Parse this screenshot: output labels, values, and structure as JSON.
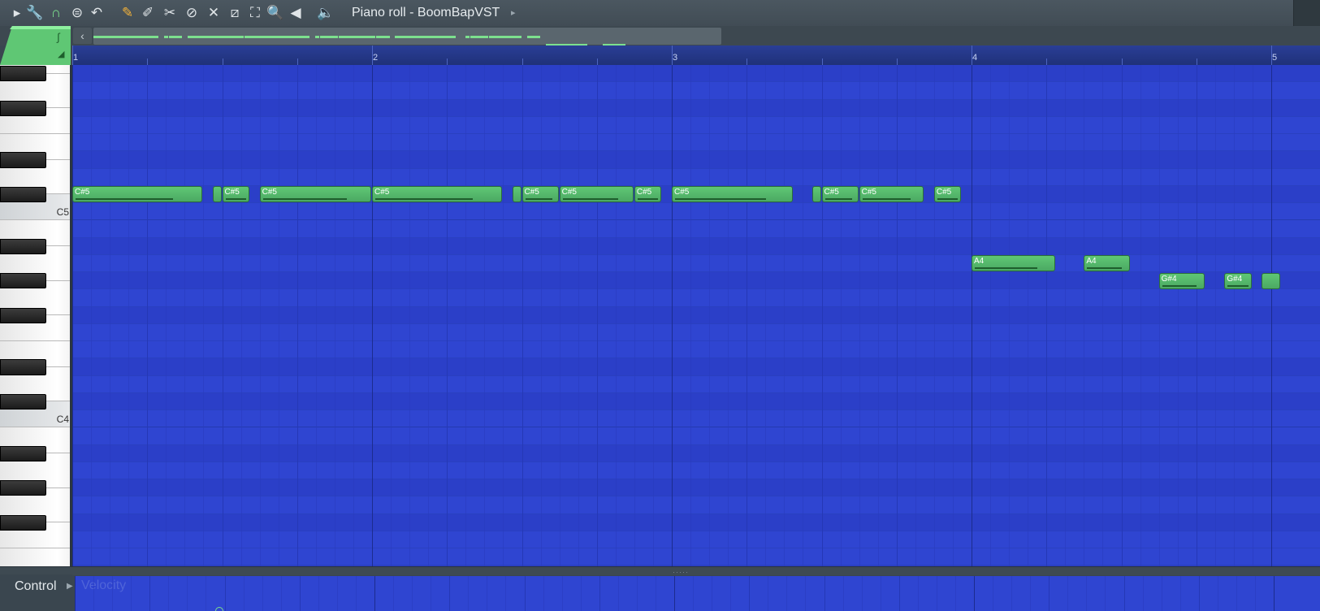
{
  "window": {
    "title": "Piano roll - BoomBapVST"
  },
  "toolbar": {
    "tools": [
      {
        "name": "menu-arrow-icon",
        "glyph": "▸",
        "color": "#e0e5e8"
      },
      {
        "name": "wrench-icon",
        "glyph": "🔧",
        "color": "#e0e5e8"
      },
      {
        "name": "magnet-icon",
        "glyph": "∩",
        "color": "#7ce08e"
      },
      {
        "name": "snap-menu-icon",
        "glyph": "⊜",
        "color": "#e0e5e8"
      },
      {
        "name": "undo-icon",
        "glyph": "↶",
        "color": "#e0e5e8"
      },
      {
        "name": "pencil-icon",
        "glyph": "✎",
        "color": "#f3b23a"
      },
      {
        "name": "paint-brush-icon",
        "glyph": "✐",
        "color": "#e0e5e8"
      },
      {
        "name": "delete-tool-icon",
        "glyph": "✂",
        "color": "#e0e5e8"
      },
      {
        "name": "erase-icon",
        "glyph": "⊘",
        "color": "#e0e5e8"
      },
      {
        "name": "mute-icon",
        "glyph": "✕",
        "color": "#e0e5e8"
      },
      {
        "name": "slice-icon",
        "glyph": "⧄",
        "color": "#e0e5e8"
      },
      {
        "name": "select-icon",
        "glyph": "⛶",
        "color": "#e0e5e8"
      },
      {
        "name": "zoom-icon",
        "glyph": "🔍",
        "color": "#e0e5e8"
      },
      {
        "name": "playback-icon",
        "glyph": "◀",
        "color": "#e0e5e8"
      },
      {
        "name": "speaker-icon",
        "glyph": "🔈",
        "color": "#e0e5e8"
      }
    ]
  },
  "ruler": {
    "bars": [
      "1",
      "2",
      "3",
      "4",
      "5"
    ]
  },
  "keyboard": {
    "labels": [
      "C5",
      "C4"
    ]
  },
  "notes": [
    {
      "label": "C#5",
      "start": 0.0,
      "len": 0.4375,
      "pitch": 73
    },
    {
      "label": "",
      "start": 0.46875,
      "len": 0.03125,
      "pitch": 73
    },
    {
      "label": "C#5",
      "start": 0.5,
      "len": 0.09375,
      "pitch": 73
    },
    {
      "label": "C#5",
      "start": 0.625,
      "len": 0.375,
      "pitch": 73
    },
    {
      "label": "C#5",
      "start": 1.0,
      "len": 0.4375,
      "pitch": 73
    },
    {
      "label": "",
      "start": 1.46875,
      "len": 0.03125,
      "pitch": 73
    },
    {
      "label": "C#5",
      "start": 1.5,
      "len": 0.125,
      "pitch": 73
    },
    {
      "label": "C#5",
      "start": 1.625,
      "len": 0.25,
      "pitch": 73
    },
    {
      "label": "C#5",
      "start": 1.875,
      "len": 0.09375,
      "pitch": 73
    },
    {
      "label": "C#5",
      "start": 2.0,
      "len": 0.40625,
      "pitch": 73
    },
    {
      "label": "",
      "start": 2.46875,
      "len": 0.03125,
      "pitch": 73
    },
    {
      "label": "C#5",
      "start": 2.5,
      "len": 0.125,
      "pitch": 73
    },
    {
      "label": "C#5",
      "start": 2.625,
      "len": 0.21875,
      "pitch": 73
    },
    {
      "label": "C#5",
      "start": 2.875,
      "len": 0.09375,
      "pitch": 73
    },
    {
      "label": "A4",
      "start": 3.0,
      "len": 0.28125,
      "pitch": 69
    },
    {
      "label": "A4",
      "start": 3.375,
      "len": 0.15625,
      "pitch": 69
    },
    {
      "label": "G#4",
      "start": 3.625,
      "len": 0.15625,
      "pitch": 68
    },
    {
      "label": "G#4",
      "start": 3.84375,
      "len": 0.09375,
      "pitch": 68
    },
    {
      "label": "",
      "start": 3.96875,
      "len": 0.0625,
      "pitch": 68
    }
  ],
  "control": {
    "label": "Control",
    "param": "Velocity"
  },
  "colors": {
    "grid": "#2f45d1",
    "note": "#5fc774",
    "accent": "#7ce08e"
  }
}
